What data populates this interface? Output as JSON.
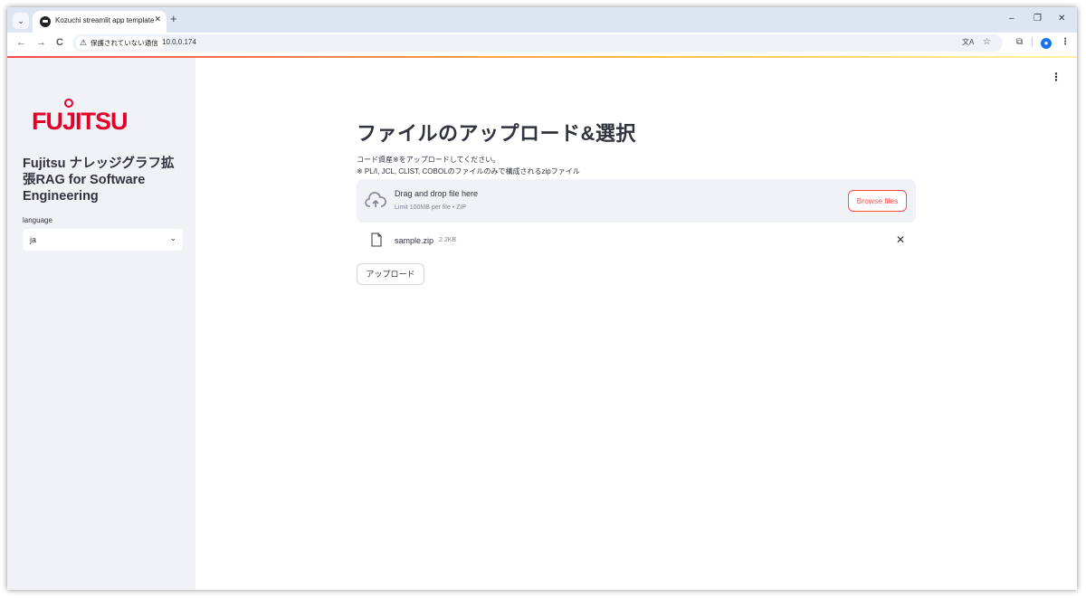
{
  "browser": {
    "tab_title": "Kozuchi streamlit app template",
    "tab_menu_icon": "chevron-down-icon",
    "tab_close": "✕",
    "new_tab": "+",
    "minimize": "–",
    "restore": "❐",
    "close": "✕",
    "back": "←",
    "forward": "→",
    "reload": "C",
    "security_label": "保護されていない通信",
    "url": "10.0.0.174"
  },
  "sidebar": {
    "logo_text": "FUJITSU",
    "app_title": "Fujitsu ナレッジグラフ拡張RAG for Software Engineering",
    "language_label": "language",
    "language_value": "ja"
  },
  "main": {
    "title": "ファイルのアップロード&選択",
    "help_line1": "コード資産※をアップロードしてください。",
    "help_line2": "※ PL/I, JCL, CLIST, COBOLのファイルのみで構成されるzipファイル",
    "drop_title": "Drag and drop file here",
    "drop_limit": "Limit 100MB per file • ZIP",
    "browse_label": "Browse files",
    "file_name": "sample.zip",
    "file_size": "2.2KB",
    "upload_label": "アップロード"
  },
  "colors": {
    "accent": "#ff4b4b",
    "brand": "#e4002b",
    "sidebar_bg": "#f0f2f6",
    "text": "#31333f"
  }
}
